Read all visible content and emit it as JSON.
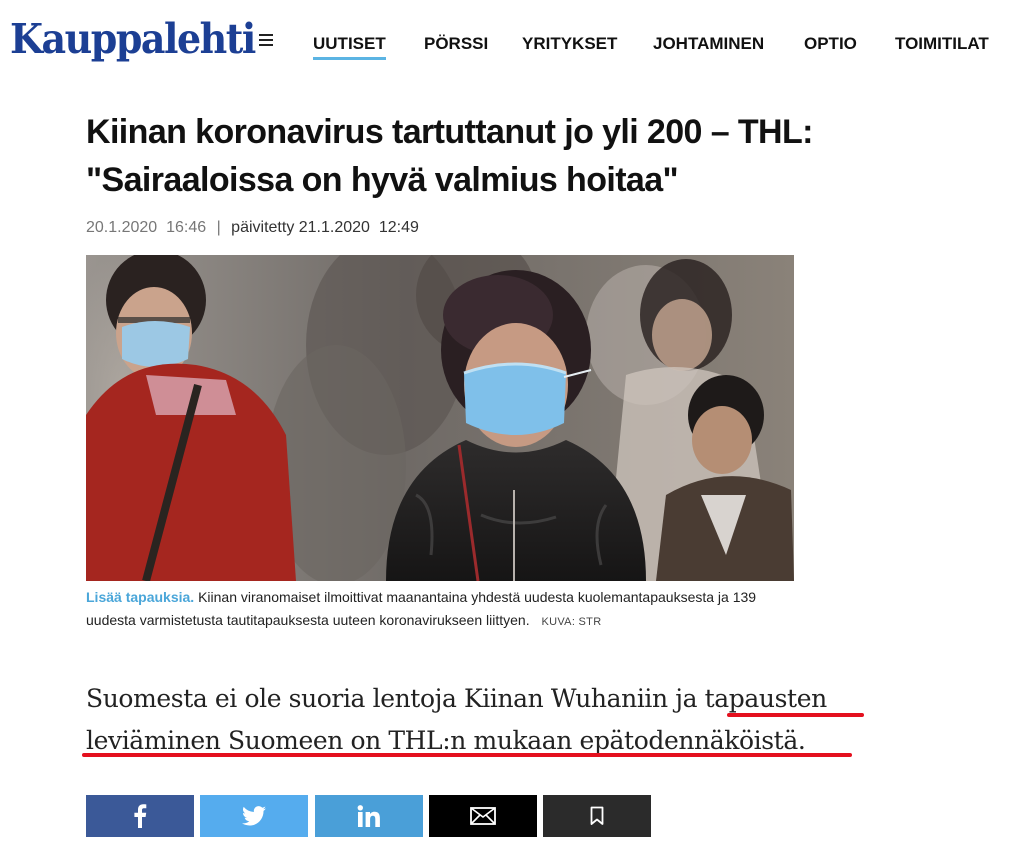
{
  "header": {
    "logo": "Kauppalehti",
    "brand_color": "#1c3f94",
    "menu_icon": "hamburger-icon",
    "nav": [
      {
        "label": "UUTISET",
        "active": true
      },
      {
        "label": "PÖRSSI",
        "active": false
      },
      {
        "label": "YRITYKSET",
        "active": false
      },
      {
        "label": "JOHTAMINEN",
        "active": false
      },
      {
        "label": "OPTIO",
        "active": false
      },
      {
        "label": "TOIMITILAT",
        "active": false
      }
    ],
    "active_underline_color": "#5bb4e3"
  },
  "article": {
    "headline_line1": "Kiinan koronavirus tartuttanut jo yli 200 – THL:",
    "headline_line2": "\"Sairaaloissa on hyvä valmius hoitaa\"",
    "published": "20.1.2020  16:46",
    "separator": "|",
    "updated": "päivitetty 21.1.2020  12:49",
    "caption": {
      "lead": "Lisää tapauksia.",
      "text": "Kiinan viranomaiset ilmoittivat maanantaina yhdestä uudesta kuolemantapauksesta ja 139 uudesta varmistetusta tautitapauksesta uuteen koronavirukseen liittyen.",
      "credit": "KUVA: STR"
    },
    "ingress_line1": "Suomesta ei ole suoria lentoja Kiinan Wuhaniin ja tapausten",
    "ingress_line2": "leviäminen Suomeen on THL:n mukaan epätodennäköistä.",
    "highlight_color": "#e4101e"
  },
  "share": [
    {
      "icon": "facebook-icon",
      "color": "#3b5998"
    },
    {
      "icon": "twitter-icon",
      "color": "#55acee"
    },
    {
      "icon": "linkedin-icon",
      "color": "#4a9fd8"
    },
    {
      "icon": "email-icon",
      "color": "#000000"
    },
    {
      "icon": "bookmark-icon",
      "color": "#2b2b2b"
    }
  ]
}
